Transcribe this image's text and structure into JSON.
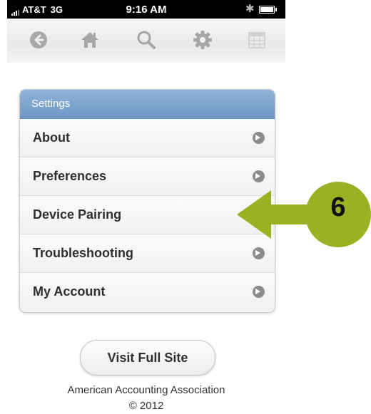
{
  "status_bar": {
    "carrier": "AT&T",
    "network": "3G",
    "time": "9:16 AM",
    "bluetooth_icon": "bluetooth-icon",
    "battery_icon": "battery-icon"
  },
  "toolbar": {
    "items": [
      {
        "icon": "back-arrow-icon"
      },
      {
        "icon": "home-icon"
      },
      {
        "icon": "search-icon"
      },
      {
        "icon": "gear-icon"
      },
      {
        "icon": "calendar-icon"
      }
    ]
  },
  "settings": {
    "header": "Settings",
    "header_color": "#7aa3cf",
    "items": [
      {
        "label": "About",
        "has_arrow": true
      },
      {
        "label": "Preferences",
        "has_arrow": true
      },
      {
        "label": "Device Pairing",
        "has_arrow": false
      },
      {
        "label": "Troubleshooting",
        "has_arrow": true
      },
      {
        "label": "My Account",
        "has_arrow": true
      }
    ]
  },
  "callout": {
    "number": "6",
    "color": "#9cb024"
  },
  "footer": {
    "button_label": "Visit Full Site",
    "organization": "American Accounting Association",
    "copyright": "© 2012"
  }
}
